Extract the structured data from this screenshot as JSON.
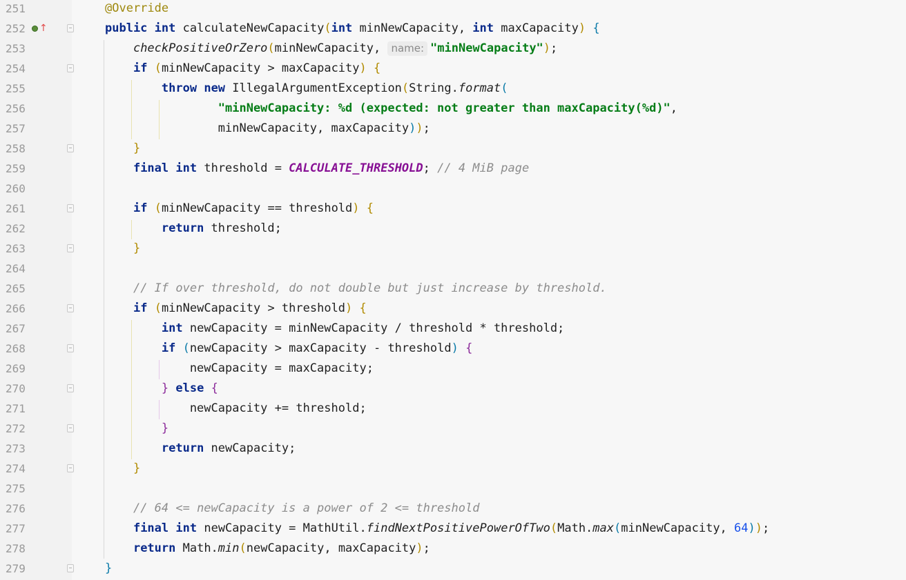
{
  "editor": {
    "lines": [
      {
        "no": "251",
        "segs": [
          {
            "c": "ann",
            "t": "@Override"
          }
        ]
      },
      {
        "no": "252",
        "segs": [
          {
            "c": "kw",
            "t": "public"
          },
          {
            "c": "",
            "t": " "
          },
          {
            "c": "kw",
            "t": "int"
          },
          {
            "c": "",
            "t": " calculateNewCapacity"
          },
          {
            "c": "p1",
            "t": "("
          },
          {
            "c": "kw",
            "t": "int"
          },
          {
            "c": "",
            "t": " minNewCapacity, "
          },
          {
            "c": "kw",
            "t": "int"
          },
          {
            "c": "",
            "t": " maxCapacity"
          },
          {
            "c": "p1",
            "t": ")"
          },
          {
            "c": "",
            "t": " "
          },
          {
            "c": "p2",
            "t": "{"
          }
        ]
      },
      {
        "no": "253",
        "segs": [
          {
            "c": "",
            "t": "    "
          },
          {
            "c": "it",
            "t": "checkPositiveOrZero"
          },
          {
            "c": "p1",
            "t": "("
          },
          {
            "c": "",
            "t": "minNewCapacity, "
          },
          {
            "c": "hint",
            "t": "name:"
          },
          {
            "c": "str",
            "t": "\"minNewCapacity\""
          },
          {
            "c": "p1",
            "t": ")"
          },
          {
            "c": "",
            "t": ";"
          }
        ]
      },
      {
        "no": "254",
        "segs": [
          {
            "c": "",
            "t": "    "
          },
          {
            "c": "kw",
            "t": "if"
          },
          {
            "c": "",
            "t": " "
          },
          {
            "c": "p1",
            "t": "("
          },
          {
            "c": "",
            "t": "minNewCapacity > maxCapacity"
          },
          {
            "c": "p1",
            "t": ")"
          },
          {
            "c": "",
            "t": " "
          },
          {
            "c": "p1",
            "t": "{"
          }
        ]
      },
      {
        "no": "255",
        "segs": [
          {
            "c": "",
            "t": "        "
          },
          {
            "c": "kw",
            "t": "throw"
          },
          {
            "c": "",
            "t": " "
          },
          {
            "c": "kw",
            "t": "new"
          },
          {
            "c": "",
            "t": " IllegalArgumentException"
          },
          {
            "c": "p1",
            "t": "("
          },
          {
            "c": "",
            "t": "String."
          },
          {
            "c": "it",
            "t": "format"
          },
          {
            "c": "p2",
            "t": "("
          }
        ]
      },
      {
        "no": "256",
        "segs": [
          {
            "c": "",
            "t": "                "
          },
          {
            "c": "str",
            "t": "\"minNewCapacity: %d (expected: not greater than maxCapacity(%d)\""
          },
          {
            "c": "",
            "t": ","
          }
        ]
      },
      {
        "no": "257",
        "segs": [
          {
            "c": "",
            "t": "                minNewCapacity, maxCapacity"
          },
          {
            "c": "p2",
            "t": ")"
          },
          {
            "c": "p1",
            "t": ")"
          },
          {
            "c": "",
            "t": ";"
          }
        ]
      },
      {
        "no": "258",
        "segs": [
          {
            "c": "",
            "t": "    "
          },
          {
            "c": "p1",
            "t": "}"
          }
        ]
      },
      {
        "no": "259",
        "segs": [
          {
            "c": "",
            "t": "    "
          },
          {
            "c": "kw",
            "t": "final"
          },
          {
            "c": "",
            "t": " "
          },
          {
            "c": "kw",
            "t": "int"
          },
          {
            "c": "",
            "t": " threshold = "
          },
          {
            "c": "const",
            "t": "CALCULATE_THRESHOLD"
          },
          {
            "c": "",
            "t": "; "
          },
          {
            "c": "cmt",
            "t": "// 4 MiB page"
          }
        ]
      },
      {
        "no": "260",
        "segs": []
      },
      {
        "no": "261",
        "segs": [
          {
            "c": "",
            "t": "    "
          },
          {
            "c": "kw",
            "t": "if"
          },
          {
            "c": "",
            "t": " "
          },
          {
            "c": "p1",
            "t": "("
          },
          {
            "c": "",
            "t": "minNewCapacity == threshold"
          },
          {
            "c": "p1",
            "t": ")"
          },
          {
            "c": "",
            "t": " "
          },
          {
            "c": "p1",
            "t": "{"
          }
        ]
      },
      {
        "no": "262",
        "segs": [
          {
            "c": "",
            "t": "        "
          },
          {
            "c": "kw",
            "t": "return"
          },
          {
            "c": "",
            "t": " threshold;"
          }
        ]
      },
      {
        "no": "263",
        "segs": [
          {
            "c": "",
            "t": "    "
          },
          {
            "c": "p1",
            "t": "}"
          }
        ]
      },
      {
        "no": "264",
        "segs": []
      },
      {
        "no": "265",
        "segs": [
          {
            "c": "",
            "t": "    "
          },
          {
            "c": "cmt",
            "t": "// If over threshold, do not double but just increase by threshold."
          }
        ]
      },
      {
        "no": "266",
        "segs": [
          {
            "c": "",
            "t": "    "
          },
          {
            "c": "kw",
            "t": "if"
          },
          {
            "c": "",
            "t": " "
          },
          {
            "c": "p1",
            "t": "("
          },
          {
            "c": "",
            "t": "minNewCapacity > threshold"
          },
          {
            "c": "p1",
            "t": ")"
          },
          {
            "c": "",
            "t": " "
          },
          {
            "c": "p1",
            "t": "{"
          }
        ]
      },
      {
        "no": "267",
        "segs": [
          {
            "c": "",
            "t": "        "
          },
          {
            "c": "kw",
            "t": "int"
          },
          {
            "c": "",
            "t": " newCapacity = minNewCapacity / threshold * threshold;"
          }
        ]
      },
      {
        "no": "268",
        "segs": [
          {
            "c": "",
            "t": "        "
          },
          {
            "c": "kw",
            "t": "if"
          },
          {
            "c": "",
            "t": " "
          },
          {
            "c": "p2",
            "t": "("
          },
          {
            "c": "",
            "t": "newCapacity > maxCapacity - threshold"
          },
          {
            "c": "p2",
            "t": ")"
          },
          {
            "c": "",
            "t": " "
          },
          {
            "c": "p3",
            "t": "{"
          }
        ]
      },
      {
        "no": "269",
        "segs": [
          {
            "c": "",
            "t": "            newCapacity = maxCapacity;"
          }
        ]
      },
      {
        "no": "270",
        "segs": [
          {
            "c": "",
            "t": "        "
          },
          {
            "c": "p3",
            "t": "}"
          },
          {
            "c": "",
            "t": " "
          },
          {
            "c": "kw",
            "t": "else"
          },
          {
            "c": "",
            "t": " "
          },
          {
            "c": "p3",
            "t": "{"
          }
        ]
      },
      {
        "no": "271",
        "segs": [
          {
            "c": "",
            "t": "            newCapacity += threshold;"
          }
        ]
      },
      {
        "no": "272",
        "segs": [
          {
            "c": "",
            "t": "        "
          },
          {
            "c": "p3",
            "t": "}"
          }
        ]
      },
      {
        "no": "273",
        "segs": [
          {
            "c": "",
            "t": "        "
          },
          {
            "c": "kw",
            "t": "return"
          },
          {
            "c": "",
            "t": " newCapacity;"
          }
        ]
      },
      {
        "no": "274",
        "segs": [
          {
            "c": "",
            "t": "    "
          },
          {
            "c": "p1",
            "t": "}"
          }
        ]
      },
      {
        "no": "275",
        "segs": []
      },
      {
        "no": "276",
        "segs": [
          {
            "c": "",
            "t": "    "
          },
          {
            "c": "cmt",
            "t": "// 64 <= newCapacity is a power of 2 <= threshold"
          }
        ]
      },
      {
        "no": "277",
        "segs": [
          {
            "c": "",
            "t": "    "
          },
          {
            "c": "kw",
            "t": "final"
          },
          {
            "c": "",
            "t": " "
          },
          {
            "c": "kw",
            "t": "int"
          },
          {
            "c": "",
            "t": " newCapacity = MathUtil."
          },
          {
            "c": "it",
            "t": "findNextPositivePowerOfTwo"
          },
          {
            "c": "p1",
            "t": "("
          },
          {
            "c": "",
            "t": "Math."
          },
          {
            "c": "it",
            "t": "max"
          },
          {
            "c": "p2",
            "t": "("
          },
          {
            "c": "",
            "t": "minNewCapacity, "
          },
          {
            "c": "num",
            "t": "64"
          },
          {
            "c": "p2",
            "t": ")"
          },
          {
            "c": "p1",
            "t": ")"
          },
          {
            "c": "",
            "t": ";"
          }
        ]
      },
      {
        "no": "278",
        "segs": [
          {
            "c": "",
            "t": "    "
          },
          {
            "c": "kw",
            "t": "return"
          },
          {
            "c": "",
            "t": " Math."
          },
          {
            "c": "it",
            "t": "min"
          },
          {
            "c": "p1",
            "t": "("
          },
          {
            "c": "",
            "t": "newCapacity, maxCapacity"
          },
          {
            "c": "p1",
            "t": ")"
          },
          {
            "c": "",
            "t": ";"
          }
        ]
      },
      {
        "no": "279",
        "segs": [
          {
            "c": "p2",
            "t": "}"
          }
        ]
      }
    ],
    "folds": [
      "252",
      "254",
      "258",
      "261",
      "263",
      "266",
      "268",
      "270",
      "272",
      "274",
      "279"
    ],
    "gutter_icons": {
      "252": "implements-override-icon"
    }
  }
}
